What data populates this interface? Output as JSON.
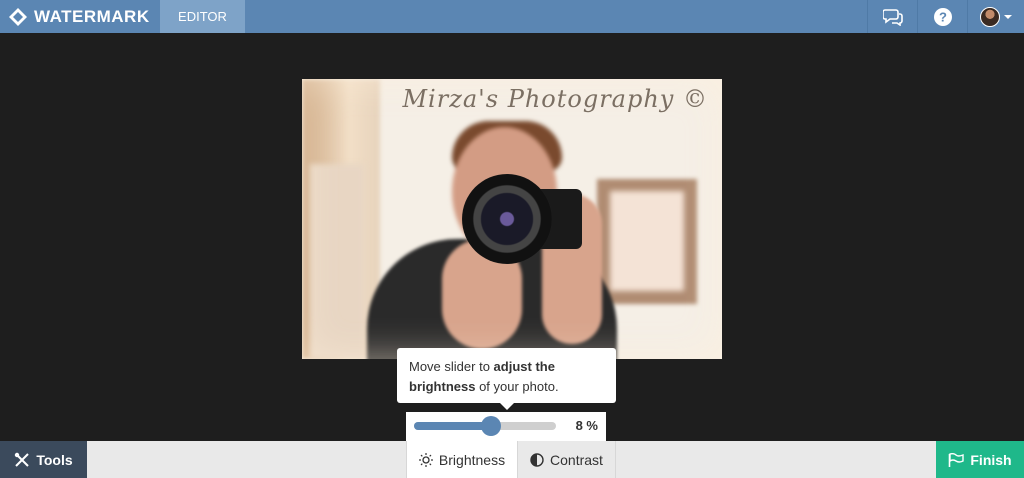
{
  "app": {
    "name": "WATERMARK",
    "tab": "EDITOR"
  },
  "photo": {
    "watermark_text": "Mirza's Photography ©"
  },
  "tooltip": {
    "part1": "Move slider to ",
    "bold1": "adjust the brightness",
    "part2": " of your photo."
  },
  "slider": {
    "value_label": "8 %",
    "value_fraction": 0.54
  },
  "bottom": {
    "tools_label": "Tools",
    "tabs": [
      {
        "label": "Brightness",
        "icon": "sun-icon",
        "active": true
      },
      {
        "label": "Contrast",
        "icon": "contrast-icon",
        "active": false
      }
    ],
    "finish_label": "Finish"
  },
  "colors": {
    "topbar": "#5b86b3",
    "finish": "#1fb88a",
    "tools": "#3b4a5c"
  }
}
